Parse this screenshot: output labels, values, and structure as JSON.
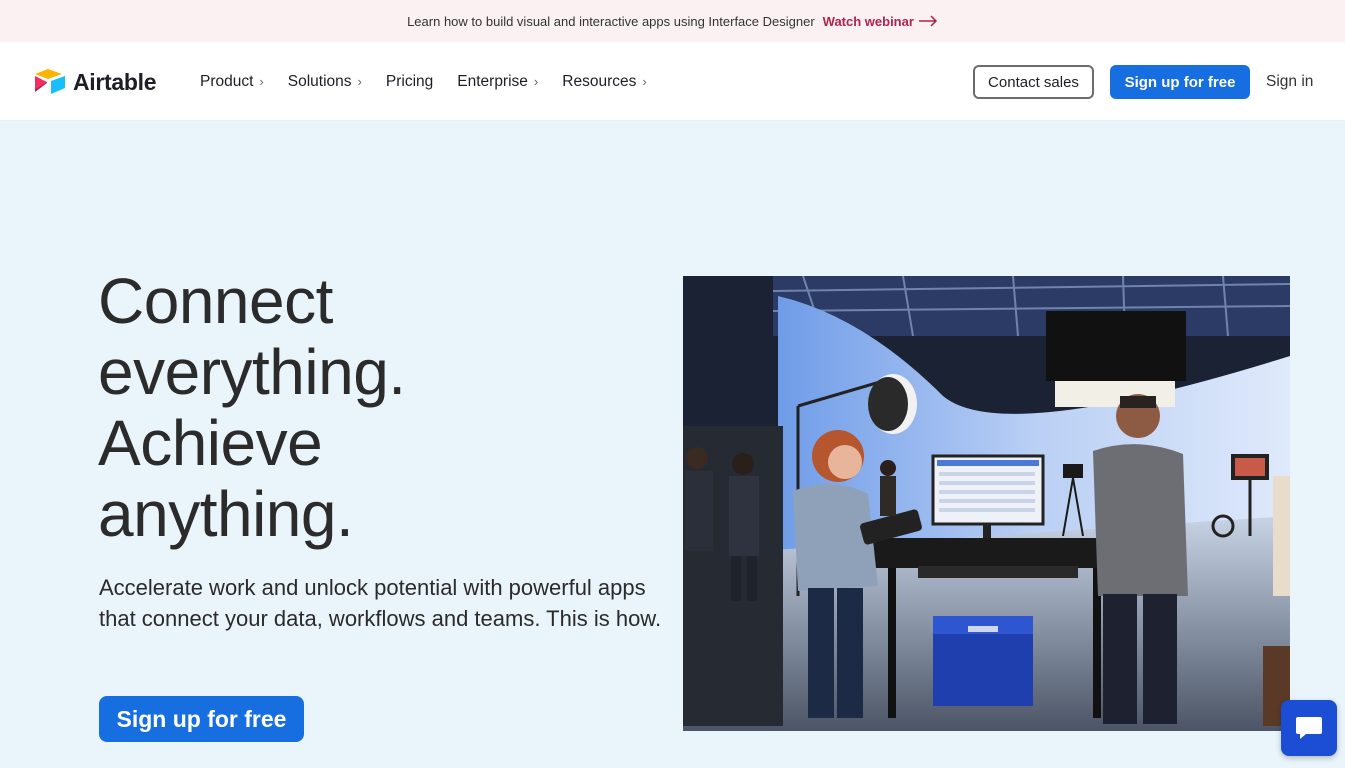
{
  "banner": {
    "text": "Learn how to build visual and interactive apps using Interface Designer",
    "link_label": "Watch webinar"
  },
  "nav": {
    "logo_text": "Airtable",
    "items": [
      {
        "label": "Product",
        "has_chevron": true
      },
      {
        "label": "Solutions",
        "has_chevron": true
      },
      {
        "label": "Pricing",
        "has_chevron": false
      },
      {
        "label": "Enterprise",
        "has_chevron": true
      },
      {
        "label": "Resources",
        "has_chevron": true
      }
    ],
    "chevron": "›",
    "contact_label": "Contact sales",
    "signup_label": "Sign up for free",
    "signin_label": "Sign in"
  },
  "hero": {
    "title_lines": [
      "Connect",
      "everything.",
      "Achieve",
      "anything."
    ],
    "subtitle": "Accelerate work and unlock potential with powerful apps that connect your data, workflows and teams. This is how.",
    "cta_label": "Sign up for free",
    "image_icon": "studio-photo"
  },
  "chat": {
    "icon": "chat-bubble-icon"
  },
  "colors": {
    "accent": "#166ee1",
    "banner_link": "#b0234b",
    "page_bg": "#eaf4fb",
    "chat_bg": "#1b4ed4"
  }
}
